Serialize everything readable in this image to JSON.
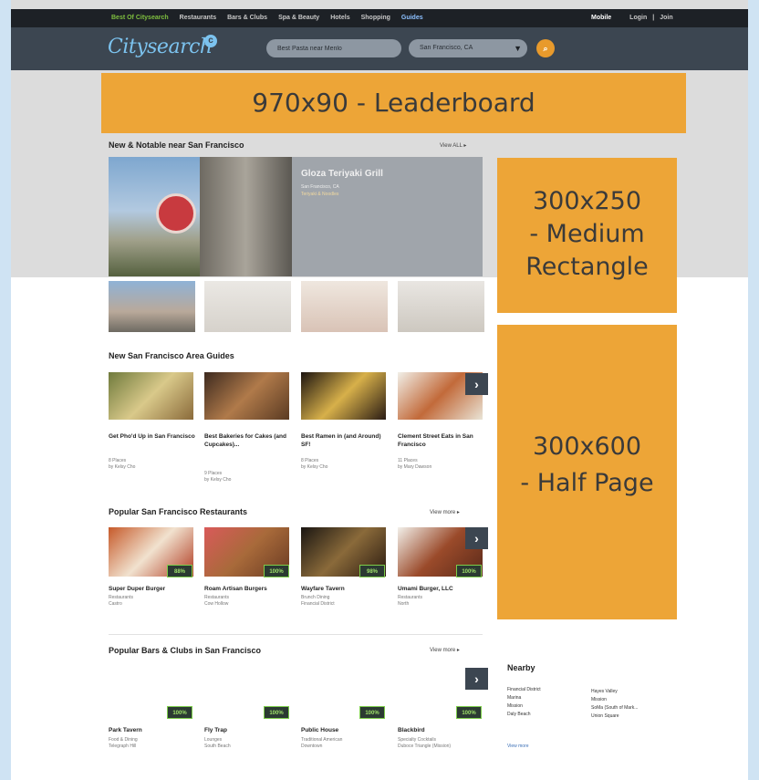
{
  "topbar": {
    "nav": [
      "Best Of Citysearch",
      "Restaurants",
      "Bars & Clubs",
      "Spa & Beauty",
      "Hotels",
      "Shopping",
      "Guides"
    ],
    "mobile": "Mobile",
    "login": "Login",
    "separator": "|",
    "join": "Join"
  },
  "header": {
    "logo": "Citysearch",
    "logo_mark": "c",
    "search_value": "Best Pasta near Menlo",
    "location_value": "San Francisco, CA",
    "go_label": "Go"
  },
  "ads": {
    "leaderboard": "970x90 - Leaderboard",
    "medium_rectangle": [
      "300x250",
      "- Medium",
      "Rectangle"
    ],
    "half_page": [
      "300x600",
      "- Half Page"
    ]
  },
  "featured": {
    "section_title": "New & Notable near San Francisco",
    "view_all": "View ALL ▸",
    "name": "Gloza Teriyaki Grill",
    "location": "San Francisco, CA",
    "category": "Teriyaki & Noodles"
  },
  "guides": {
    "section_title": "New San Francisco Area Guides",
    "items": [
      {
        "title": "Get Pho'd Up in San Francisco",
        "count": "8 Places",
        "author": "by Kelsy Cho"
      },
      {
        "title": "Best Bakeries for Cakes (and Cupcakes)...",
        "count": "9 Places",
        "author": "by Kelsy Cho"
      },
      {
        "title": "Best Ramen in (and Around) SF!",
        "count": "8 Places",
        "author": "by Kelsy Cho"
      },
      {
        "title": "Clement Street Eats in San Francisco",
        "count": "11 Places",
        "author": "by Mary Dawson"
      }
    ]
  },
  "restaurants": {
    "section_title": "Popular San Francisco Restaurants",
    "view_more": "View more ▸",
    "items": [
      {
        "name": "Super Duper Burger",
        "cat": "Restaurants",
        "hood": "Castro",
        "score": "88%"
      },
      {
        "name": "Roam Artisan Burgers",
        "cat": "Restaurants",
        "hood": "Cow Hollow",
        "score": "100%"
      },
      {
        "name": "Wayfare Tavern",
        "cat": "Brunch Dining",
        "hood": "Financial District",
        "score": "98%"
      },
      {
        "name": "Umami Burger, LLC",
        "cat": "Restaurants",
        "hood": "North",
        "score": "100%"
      }
    ]
  },
  "bars": {
    "section_title": "Popular Bars & Clubs in San Francisco",
    "view_more": "View more ▸",
    "items": [
      {
        "name": "Park Tavern",
        "cat": "Food & Dining",
        "hood": "Telegraph Hill",
        "score": "100%"
      },
      {
        "name": "Fly Trap",
        "cat": "Lounges",
        "hood": "South Beach",
        "score": "100%"
      },
      {
        "name": "Public House",
        "cat": "Traditional American",
        "hood": "Downtown",
        "score": "100%"
      },
      {
        "name": "Blackbird",
        "cat": "Specialty Cocktails",
        "hood": "Duboce Triangle (Mission)",
        "score": "100%"
      }
    ]
  },
  "nearby": {
    "title": "Nearby",
    "col1": [
      "Financial District",
      "Marina",
      "Mission",
      "Daly Beach"
    ],
    "col2": [
      "Hayes Valley",
      "Mission",
      "SoMa (South of Mark...",
      "Union Square"
    ],
    "more": "View more"
  },
  "colors": {
    "ad": "#eda537",
    "header": "#3c4651",
    "topbar": "#1d2126",
    "accent_blue": "#7cc3ef",
    "score_green": "#9ee06a"
  }
}
